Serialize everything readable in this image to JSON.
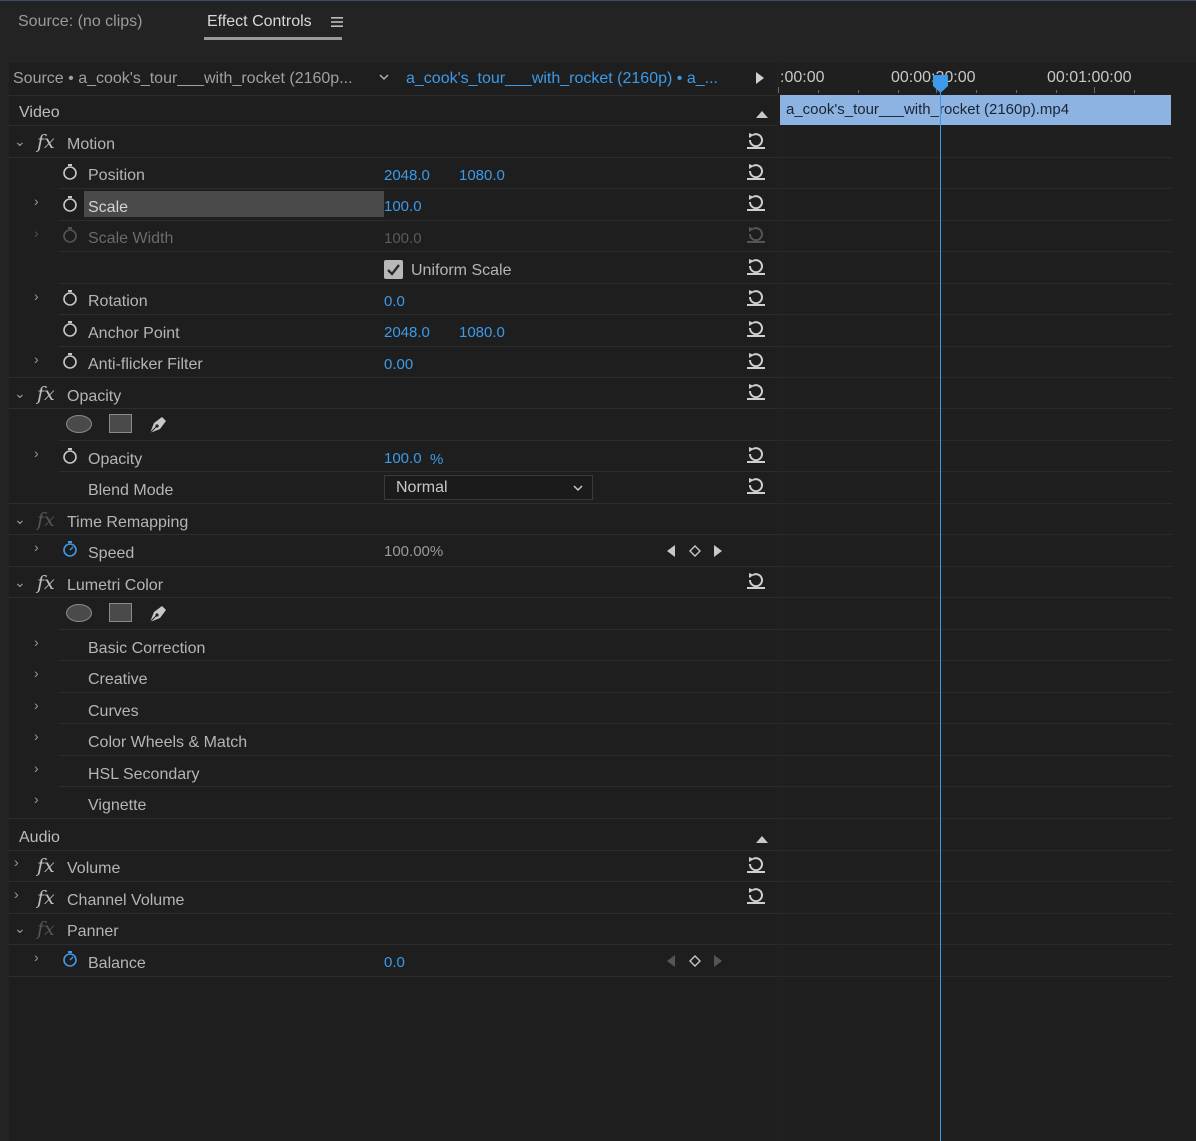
{
  "tabs": {
    "source": "Source: (no clips)",
    "effect_controls": "Effect Controls"
  },
  "clip_header": {
    "source_label": "Source • a_cook's_tour___with_rocket (2160p...",
    "sequence_label": "a_cook's_tour___with_rocket (2160p) • a_..."
  },
  "timeline": {
    "times": [
      ":00:00",
      "00:00:30:00",
      "00:01:00:00"
    ],
    "clip_name": "a_cook's_tour___with_rocket (2160p).mp4"
  },
  "sections": {
    "video": "Video",
    "audio": "Audio"
  },
  "motion": {
    "title": "Motion",
    "position_label": "Position",
    "position_x": "2048.0",
    "position_y": "1080.0",
    "scale_label": "Scale",
    "scale_value": "100.0",
    "scale_width_label": "Scale Width",
    "scale_width_value": "100.0",
    "uniform_scale_label": "Uniform Scale",
    "rotation_label": "Rotation",
    "rotation_value": "0.0",
    "anchor_label": "Anchor Point",
    "anchor_x": "2048.0",
    "anchor_y": "1080.0",
    "antiflicker_label": "Anti-flicker Filter",
    "antiflicker_value": "0.00"
  },
  "opacity": {
    "title": "Opacity",
    "opacity_label": "Opacity",
    "opacity_value": "100.0",
    "opacity_unit": "%",
    "blend_label": "Blend Mode",
    "blend_value": "Normal"
  },
  "time_remap": {
    "title": "Time Remapping",
    "speed_label": "Speed",
    "speed_value": "100.00%"
  },
  "lumetri": {
    "title": "Lumetri Color",
    "items": [
      "Basic Correction",
      "Creative",
      "Curves",
      "Color Wheels & Match",
      "HSL Secondary",
      "Vignette"
    ]
  },
  "audio": {
    "volume": "Volume",
    "channel_volume": "Channel Volume",
    "panner": "Panner",
    "balance_label": "Balance",
    "balance_value": "0.0"
  },
  "colors": {
    "accent": "#3d9ae8",
    "clip": "#8db3e2"
  }
}
